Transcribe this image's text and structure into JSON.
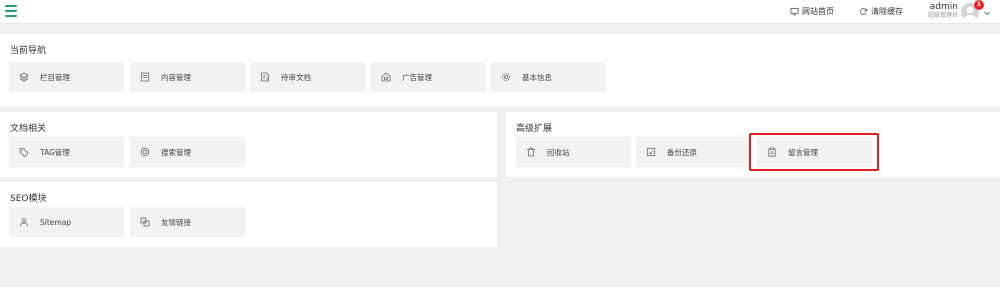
{
  "topbar": {
    "site_home": "网站首页",
    "clear_cache": "清除缓存",
    "user_name": "admin",
    "user_role": "超级管理员",
    "badge_count": "1"
  },
  "panels": {
    "current_nav": {
      "title": "当前导航",
      "tiles": [
        {
          "label": "栏目管理",
          "icon": "layers-icon"
        },
        {
          "label": "内容管理",
          "icon": "document-list-icon"
        },
        {
          "label": "待审文档",
          "icon": "edit-document-icon"
        },
        {
          "label": "广告管理",
          "icon": "home-ad-icon"
        },
        {
          "label": "基本信息",
          "icon": "gear-icon"
        }
      ]
    },
    "doc_related": {
      "title": "文档相关",
      "tiles": [
        {
          "label": "TAG管理",
          "icon": "tag-icon"
        },
        {
          "label": "搜索管理",
          "icon": "search-target-icon"
        }
      ]
    },
    "advanced": {
      "title": "高级扩展",
      "tiles": [
        {
          "label": "回收站",
          "icon": "trash-icon"
        },
        {
          "label": "备份还原",
          "icon": "backup-icon"
        },
        {
          "label": "留言管理",
          "icon": "clipboard-icon"
        }
      ]
    },
    "seo": {
      "title": "SEO模块",
      "tiles": [
        {
          "label": "Sitemap",
          "icon": "sitemap-icon"
        },
        {
          "label": "友情链接",
          "icon": "link-icon"
        }
      ]
    }
  },
  "colors": {
    "accent": "#1e9c74",
    "highlight": "#e02020",
    "badge": "#e5252a"
  }
}
